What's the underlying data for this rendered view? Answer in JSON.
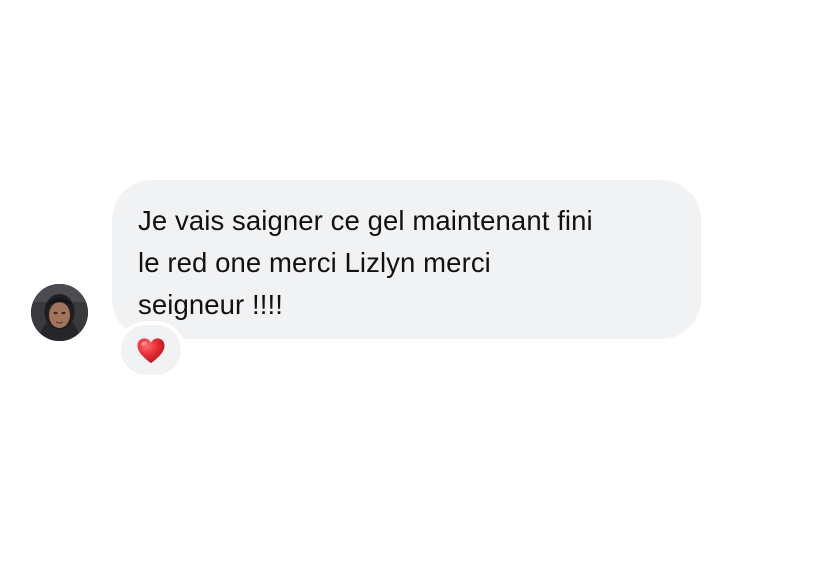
{
  "message": {
    "text": "Je vais saigner ce gel maintenant fini\nle red one merci Lizlyn merci\nseigneur !!!!",
    "bubble_color": "#f1f2f4",
    "text_color": "#111111"
  },
  "reaction": {
    "icon": "red-heart-icon",
    "color": "#e0202a"
  },
  "avatar": {
    "icon": "profile-photo"
  }
}
